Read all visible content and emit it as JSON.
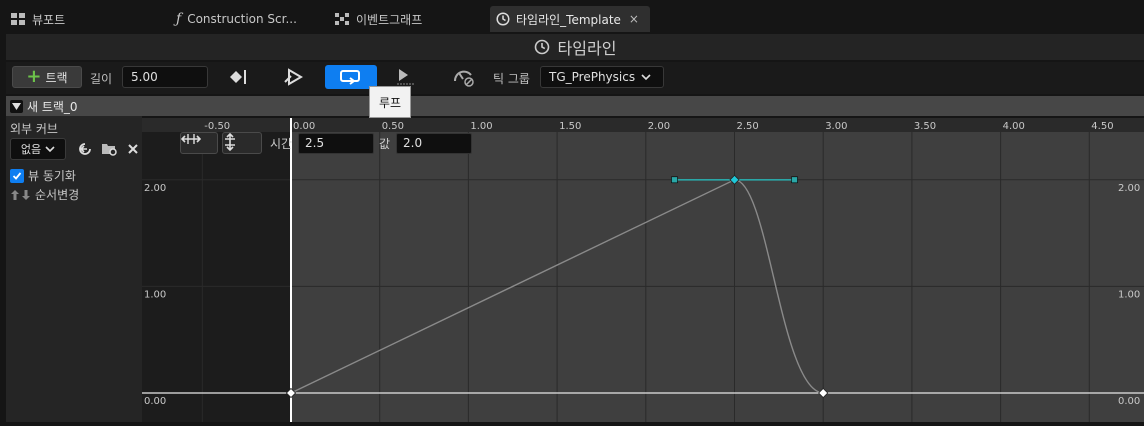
{
  "tabs": [
    {
      "label": "뷰포트",
      "icon": "viewport-grid-icon"
    },
    {
      "label": "Construction Scr...",
      "icon": "function-icon"
    },
    {
      "label": "이벤트그래프",
      "icon": "event-graph-icon"
    },
    {
      "label": "타임라인_Template",
      "icon": "clock-icon",
      "active": true,
      "close": "×"
    }
  ],
  "title": {
    "label": "타임라인",
    "icon": "clock-icon"
  },
  "toolbar": {
    "add_track_label": "트랙",
    "length_label": "길이",
    "length_value": "5.00",
    "tick_group_label": "틱 그룹",
    "tick_group_value": "TG_PrePhysics",
    "loop_active": true
  },
  "tooltip": {
    "text": "루프"
  },
  "track": {
    "name": "새 트랙_0"
  },
  "left_panel": {
    "external_curve_label": "외부 커브",
    "dropdown_value": "없음",
    "sync_view_label": "뷰 동기화",
    "sync_view_checked": true,
    "reorder_label": "순서변경"
  },
  "graph": {
    "time_label": "시간",
    "time_value": "2.5",
    "value_label": "값",
    "value_value": "2.0",
    "x_ticks": [
      "-0.50",
      "0.00",
      "0.50",
      "1.00",
      "1.50",
      "2.00",
      "2.50",
      "3.00",
      "3.50",
      "4.00",
      "4.50"
    ],
    "y_ticks": [
      "2.00",
      "1.00",
      "0.00"
    ],
    "keys": [
      {
        "time": 0.0,
        "value": 0.0
      },
      {
        "time": 2.5,
        "value": 2.0,
        "selected": true
      },
      {
        "time": 3.0,
        "value": 0.0
      }
    ],
    "colors": {
      "curve": "#8a8a8a",
      "tangent": "#2aa7a7",
      "selected_key": "#1ec8d8",
      "bg": "#3f3f3f",
      "inactive_bg": "#1c1c1c"
    }
  }
}
